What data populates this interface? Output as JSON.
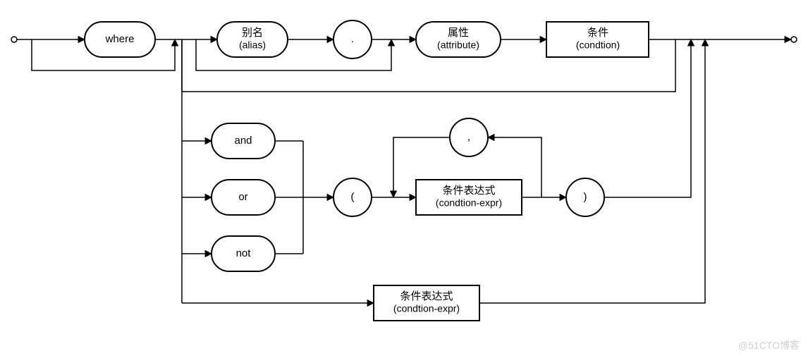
{
  "diagram": {
    "type": "railroad-syntax-diagram",
    "nodes": {
      "where": {
        "label": "where"
      },
      "alias": {
        "label_top": "别名",
        "label_bottom": "(alias)"
      },
      "dot": {
        "label": "."
      },
      "attribute": {
        "label_top": "属性",
        "label_bottom": "(attribute)"
      },
      "condition": {
        "label_top": "条件",
        "label_bottom": "(condtion)"
      },
      "and": {
        "label": "and"
      },
      "or": {
        "label": "or"
      },
      "not": {
        "label": "not"
      },
      "lparen": {
        "label": "("
      },
      "rparen": {
        "label": ")"
      },
      "comma": {
        "label": ","
      },
      "condexpr": {
        "label_top": "条件表达式",
        "label_bottom": "(condtion-expr)"
      },
      "condexpr2": {
        "label_top": "条件表达式",
        "label_bottom": "(condtion-expr)"
      }
    }
  },
  "watermark": "@51CTO博客"
}
